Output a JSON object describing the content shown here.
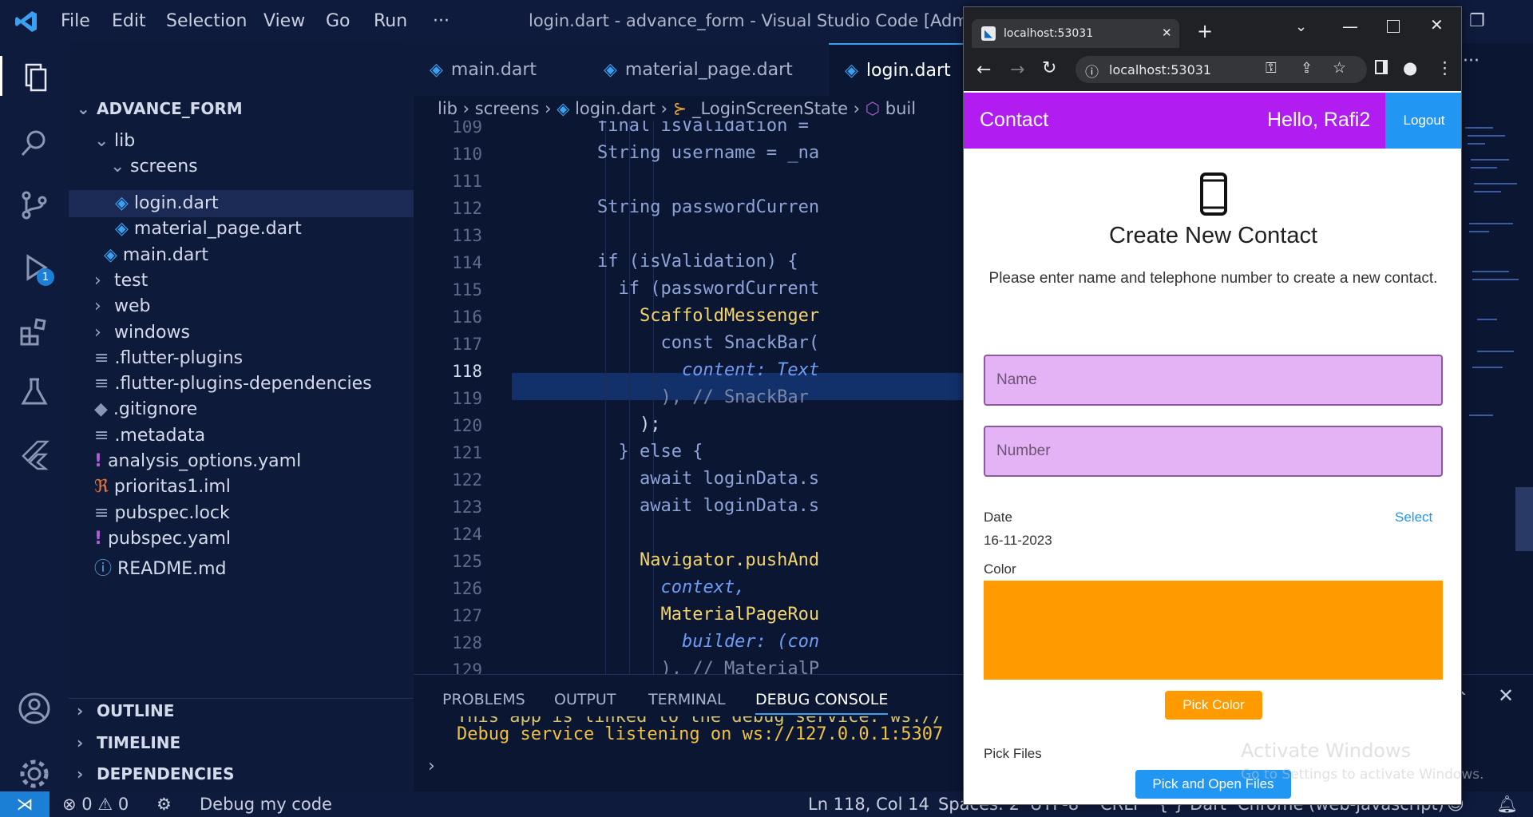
{
  "titlebar": {
    "menus": [
      "File",
      "Edit",
      "Selection",
      "View",
      "Go",
      "Run"
    ],
    "more": "···",
    "title": "login.dart - advance_form - Visual Studio Code [Administ"
  },
  "debug_toolbar": {
    "more": "···"
  },
  "activity": {
    "debug_badge": "1"
  },
  "sidebar": {
    "project": "ADVANCE_FORM",
    "items": [
      {
        "label": "lib"
      },
      {
        "label": "screens"
      },
      {
        "label": "login.dart"
      },
      {
        "label": "material_page.dart"
      },
      {
        "label": "main.dart"
      },
      {
        "label": "test"
      },
      {
        "label": "web"
      },
      {
        "label": "windows"
      },
      {
        "label": ".flutter-plugins"
      },
      {
        "label": ".flutter-plugins-dependencies"
      },
      {
        "label": ".gitignore"
      },
      {
        "label": ".metadata"
      },
      {
        "label": "analysis_options.yaml"
      },
      {
        "label": "prioritas1.iml"
      },
      {
        "label": "pubspec.lock"
      },
      {
        "label": "pubspec.yaml"
      },
      {
        "label": "README.md"
      }
    ],
    "sections": [
      "OUTLINE",
      "TIMELINE",
      "DEPENDENCIES"
    ]
  },
  "editor": {
    "tabs": [
      "main.dart",
      "material_page.dart",
      "login.dart"
    ],
    "breadcrumb": [
      "lib",
      "screens",
      "login.dart",
      "_LoginScreenState",
      "buil"
    ],
    "lines": [
      {
        "n": "109",
        "text": "final isValidation ="
      },
      {
        "n": "110",
        "text": "String username = _na"
      },
      {
        "n": "111",
        "text": ""
      },
      {
        "n": "112",
        "text": "String passwordCurren"
      },
      {
        "n": "113",
        "text": ""
      },
      {
        "n": "114",
        "text": "if (isValidation) {"
      },
      {
        "n": "115",
        "text": "  if (passwordCurrent"
      },
      {
        "n": "116",
        "text": "    ScaffoldMessenger"
      },
      {
        "n": "117",
        "text": "      const SnackBar("
      },
      {
        "n": "118",
        "text": "        content: Text"
      },
      {
        "n": "119",
        "text": "      ), // SnackBar"
      },
      {
        "n": "120",
        "text": "    );"
      },
      {
        "n": "121",
        "text": "  } else {"
      },
      {
        "n": "122",
        "text": "    await loginData.s"
      },
      {
        "n": "123",
        "text": "    await loginData.s"
      },
      {
        "n": "124",
        "text": ""
      },
      {
        "n": "125",
        "text": "    Navigator.pushAnd"
      },
      {
        "n": "126",
        "text": "      context,"
      },
      {
        "n": "127",
        "text": "      MaterialPageRou"
      },
      {
        "n": "128",
        "text": "        builder: (con"
      },
      {
        "n": "129",
        "text": "      ), // MaterialP"
      }
    ]
  },
  "panel": {
    "tabs": [
      "PROBLEMS",
      "OUTPUT",
      "TERMINAL",
      "DEBUG CONSOLE"
    ],
    "line1": "This app is linked to the debug service: ws://",
    "line2": "Debug service listening on ws://127.0.0.1:5307"
  },
  "statusbar": {
    "errors": "0",
    "warnings": "0",
    "debug": "Debug my code",
    "position": "Ln 118, Col 14",
    "spaces": "Spaces: 2",
    "encoding": "UTF-8",
    "eol": "CRLF",
    "language": "Dart",
    "device": "Chrome (web-javascript)"
  },
  "browser": {
    "tab_title": "localhost:53031",
    "url": "localhost:53031"
  },
  "app": {
    "appbar_title": "Contact",
    "greeting": "Hello, Rafi2",
    "logout": "Logout",
    "heading": "Create New Contact",
    "description": "Please enter name and telephone number to create a new contact.",
    "name_placeholder": "Name",
    "number_placeholder": "Number",
    "date_label": "Date",
    "date_value": "16-11-2023",
    "select": "Select",
    "color_label": "Color",
    "picked_color": "#ff9a00",
    "pick_color": "Pick Color",
    "files_label": "Pick Files",
    "pick_files": "Pick and Open Files"
  },
  "watermark": {
    "line1": "Activate Windows",
    "line2": "Go to Settings to activate Windows."
  },
  "colors": {
    "vscode_bg": "#0b1633",
    "appbar": "#b11cf0",
    "accent_blue": "#2196f3"
  }
}
